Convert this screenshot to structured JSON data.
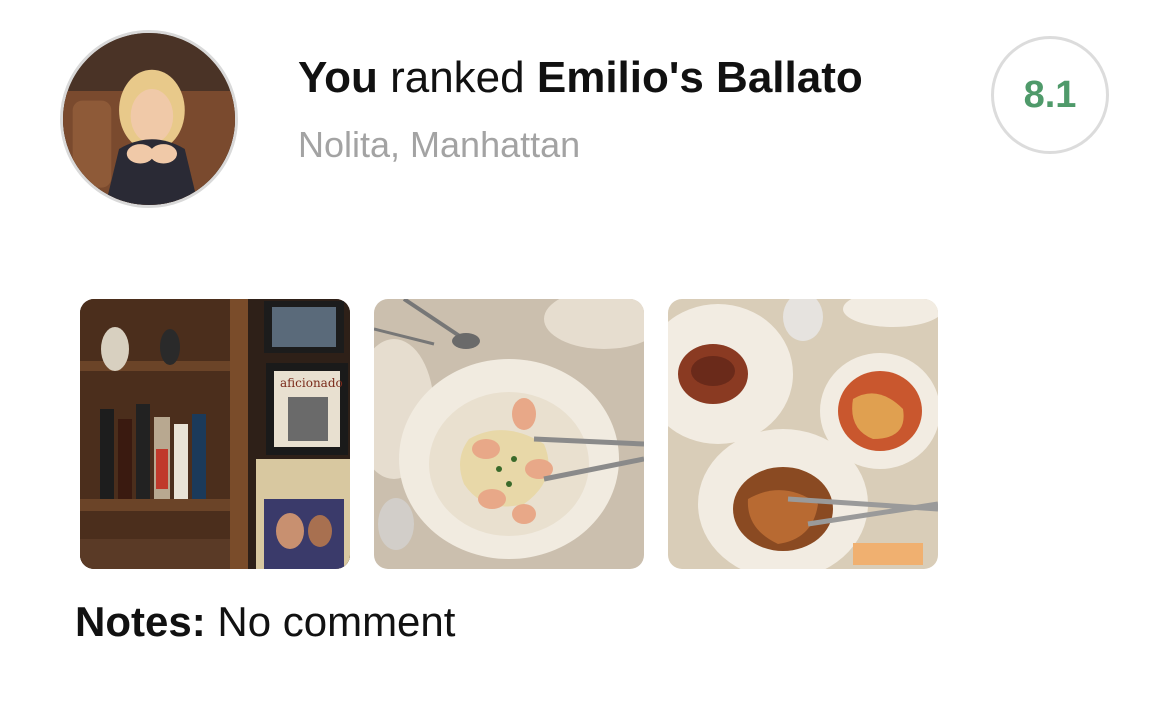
{
  "activity": {
    "subject": "You",
    "verb": "ranked",
    "restaurant": "Emilio's Ballato",
    "location": "Nolita, Manhattan",
    "score": "8.1",
    "score_color": "#4f9a6a"
  },
  "photos": [
    {
      "label": "bar-shelf-photo"
    },
    {
      "label": "pasta-dish-photo"
    },
    {
      "label": "table-dishes-photo"
    }
  ],
  "magazine_text": "aficionado",
  "notes": {
    "label": "Notes:",
    "text": "No comment"
  }
}
